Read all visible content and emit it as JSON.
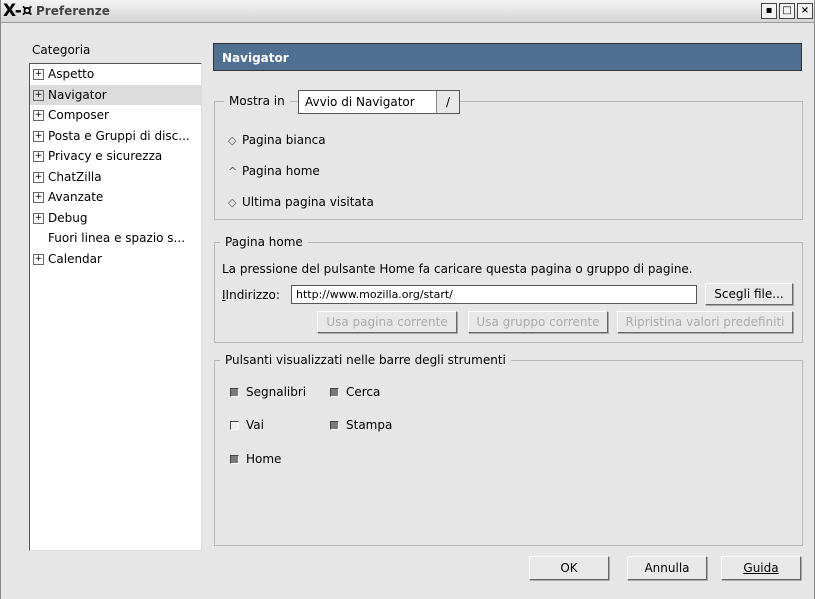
{
  "window": {
    "logo": "X-¤",
    "title": "Preferenze"
  },
  "sidebar": {
    "label": "Categoria",
    "items": [
      {
        "label": "Aspetto",
        "expandable": true
      },
      {
        "label": "Navigator",
        "expandable": true,
        "selected": true
      },
      {
        "label": "Composer",
        "expandable": true
      },
      {
        "label": "Posta e Gruppi di disc...",
        "expandable": true
      },
      {
        "label": "Privacy e sicurezza",
        "expandable": true
      },
      {
        "label": "ChatZilla",
        "expandable": true
      },
      {
        "label": "Avanzate",
        "expandable": true
      },
      {
        "label": "Debug",
        "expandable": true
      },
      {
        "label": "Fuori linea e spazio s...",
        "expandable": false
      },
      {
        "label": "Calendar",
        "expandable": true
      }
    ]
  },
  "panel": {
    "header": "Navigator",
    "startup": {
      "label": "Mostra in",
      "selected": "Avvio di Navigator",
      "options": [
        {
          "label": "Pagina bianca",
          "checked": false
        },
        {
          "label": "Pagina home",
          "checked": true
        },
        {
          "label": "Ultima pagina visitata",
          "checked": false
        }
      ]
    },
    "home": {
      "legend": "Pagina home",
      "description": "La pressione del pulsante Home fa caricare questa pagina o gruppo di pagine.",
      "address_label": "Indirizzo:",
      "address_value": "http://www.mozilla.org/start/",
      "choose_file": "Scegli file...",
      "use_current_page": "Usa pagina corrente",
      "use_current_group": "Usa gruppo corrente",
      "restore_defaults": "Ripristina valori predefiniti"
    },
    "toolbar": {
      "legend": "Pulsanti visualizzati nelle barre degli strumenti",
      "items": [
        {
          "label": "Segnalibri",
          "checked": true
        },
        {
          "label": "Cerca",
          "checked": true
        },
        {
          "label": "Vai",
          "checked": false
        },
        {
          "label": "Stampa",
          "checked": true
        },
        {
          "label": "Home",
          "checked": true
        }
      ]
    }
  },
  "footer": {
    "ok": "OK",
    "cancel": "Annulla",
    "help": "Guida"
  }
}
